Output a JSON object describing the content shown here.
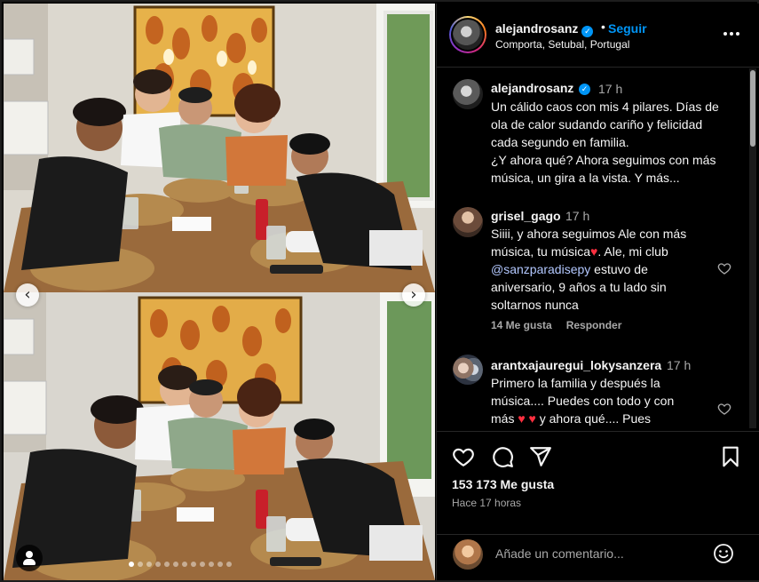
{
  "post": {
    "username": "alejandrosanz",
    "verified_mark": "✓",
    "separator": "•",
    "follow_label": "Seguir",
    "location": "Comporta, Setubal, Portugal",
    "more_icon": "more-horizontal-icon"
  },
  "media": {
    "prev_arrow": "‹",
    "next_arrow": "›",
    "carousel_count": 12,
    "carousel_active": 0,
    "tag_icon": "user-tag-icon"
  },
  "caption": {
    "username": "alejandrosanz",
    "time": "17 h",
    "text": "Un cálido caos con mis 4 pilares. Días de ola de calor sudando cariño y felicidad cada segundo en familia.\n¿Y ahora qué? Ahora seguimos con más música, un gira a la vista. Y más..."
  },
  "comments": [
    {
      "username": "grisel_gago",
      "time": "17 h",
      "text_before": "Siiii, y ahora seguimos Ale con más música, tu música",
      "heart": "♥",
      "text_middle": ". Ale, mi club ",
      "mention": "@sanzparadisepy",
      "text_after": " estuvo de aniversario, 9 años a tu lado sin soltarnos nunca",
      "likes": "14 Me gusta",
      "reply": "Responder"
    },
    {
      "username": "arantxajauregui_lokysanzera",
      "time": "17 h",
      "text_before": "Primero la familia y después la música.... Puedes con todo y con más ",
      "hearts": "♥ ♥",
      "text_after": " y ahora qué.... Pues"
    }
  ],
  "actions": {
    "like_icon": "heart-icon",
    "comment_icon": "comment-icon",
    "share_icon": "share-icon",
    "save_icon": "bookmark-icon",
    "likes": "153 173 Me gusta",
    "time_ago": "Hace 17 horas"
  },
  "comment_box": {
    "placeholder": "Añade un comentario...",
    "emoji_icon": "emoji-icon"
  },
  "colors": {
    "accent_blue": "#0095f6",
    "background": "#000000",
    "text_primary": "#f5f5f5",
    "text_secondary": "#a8a8a8",
    "heart": "#ff3040"
  }
}
